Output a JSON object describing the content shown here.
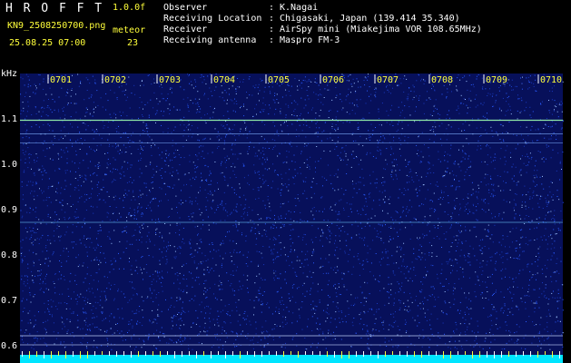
{
  "header": {
    "program": "H R O F F T",
    "version": "1.0.0f",
    "filename": "KN9_2508250700.png",
    "datetime": "25.08.25 07:00",
    "meteor_label": "meteor",
    "meteor_count": "23",
    "info": [
      {
        "label": "Observer",
        "sep": ":",
        "value": "K.Nagai"
      },
      {
        "label": "Receiving Location",
        "sep": ":",
        "value": "Chigasaki, Japan (139.414 35.340)"
      },
      {
        "label": "Receiver",
        "sep": ":",
        "value": "AirSpy mini (Miakejima VOR 108.65MHz)"
      },
      {
        "label": "Receiving antenna",
        "sep": ":",
        "value": "Maspro FM-3"
      }
    ]
  },
  "spectrogram": {
    "y_unit": "kHz",
    "y_ticks": [
      "1.1",
      "1.0",
      "0.9",
      "0.8",
      "0.7",
      "0.6"
    ],
    "time_labels": [
      "0701",
      "0702",
      "0703",
      "0704",
      "0705",
      "0706",
      "0707",
      "0708",
      "0709",
      "0710"
    ],
    "colors": {
      "background": "#07105a",
      "noise": "#2a5cff",
      "signal": "#9fffb0",
      "baseline": "#00e5ff",
      "tick": "#ffff3a"
    }
  }
}
